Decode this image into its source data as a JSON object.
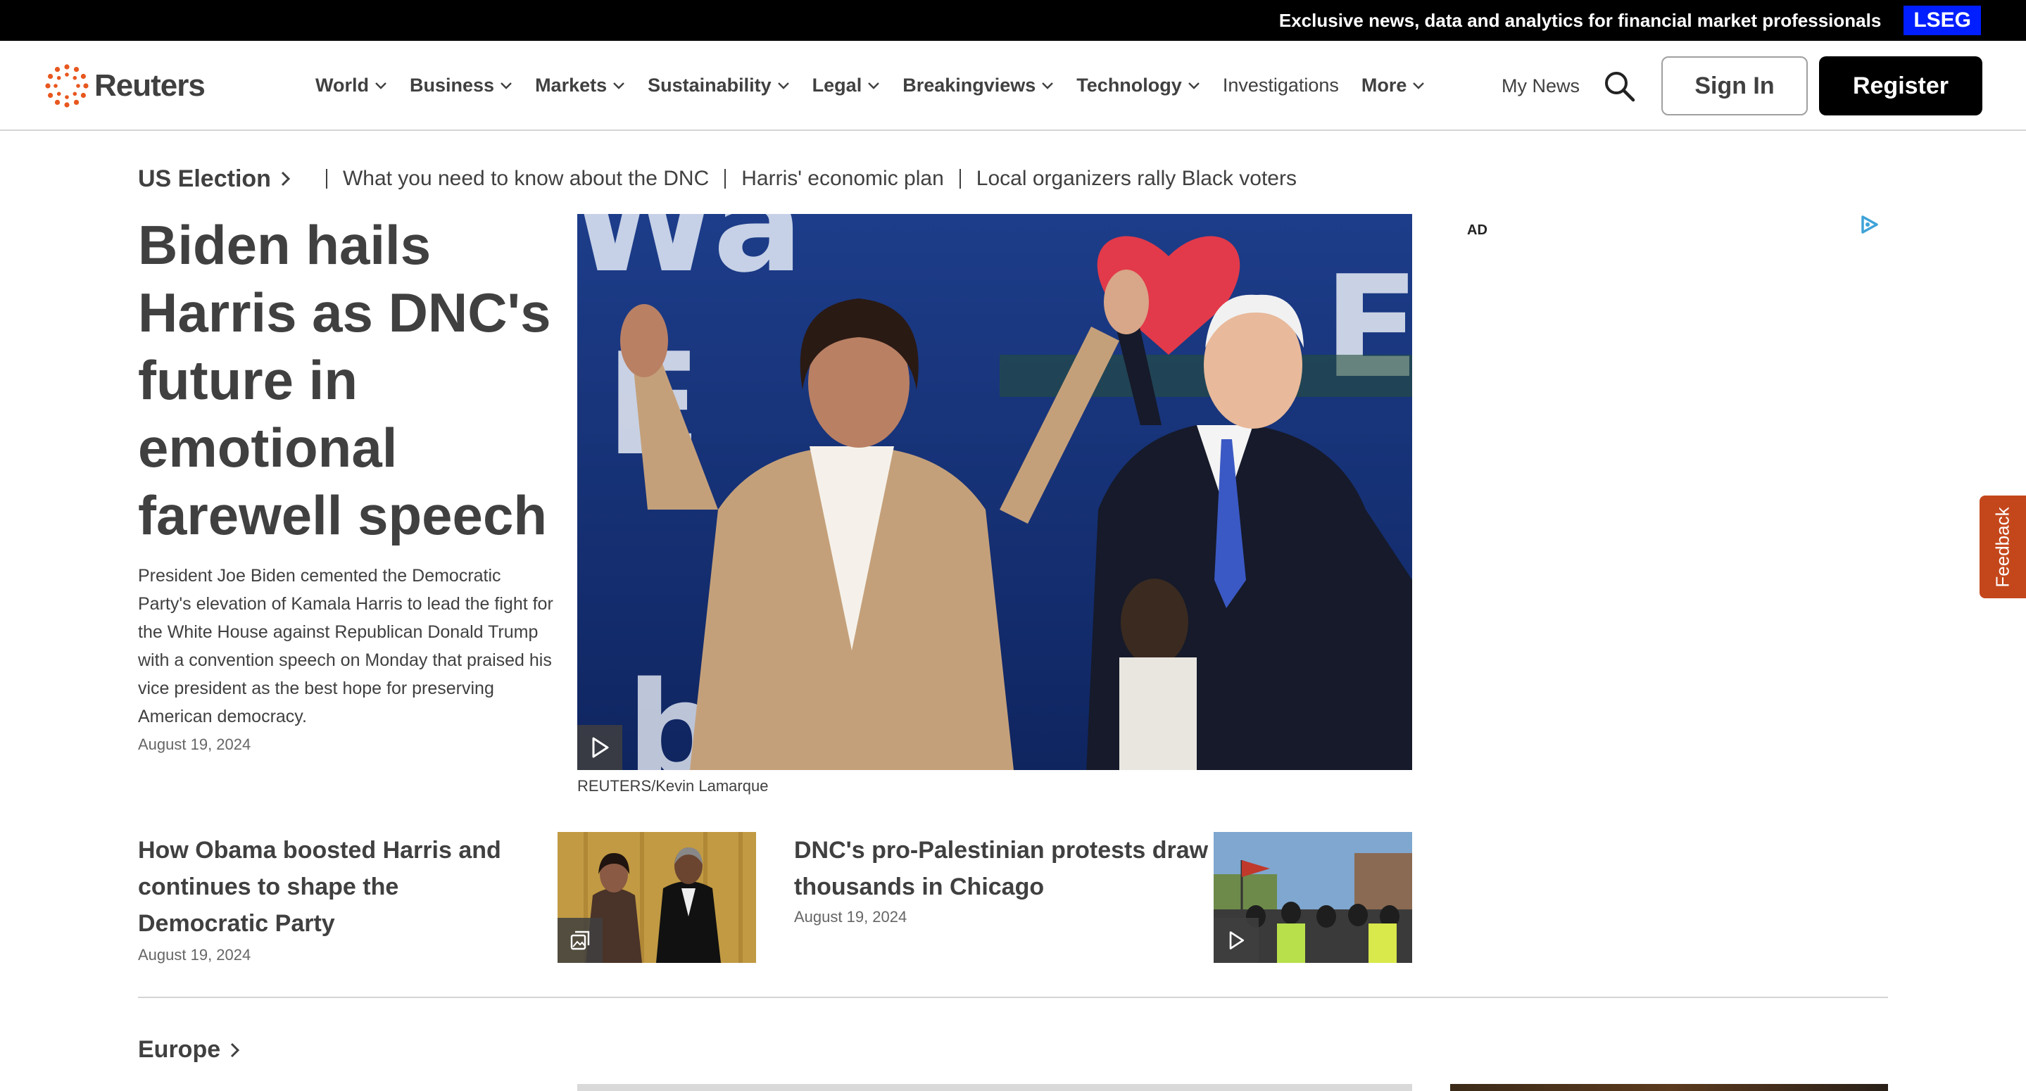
{
  "promo": {
    "text": "Exclusive news, data and analytics for financial market professionals",
    "badge": "LSEG"
  },
  "nav": {
    "logo_text": "Reuters",
    "items": [
      {
        "label": "World",
        "dropdown": true
      },
      {
        "label": "Business",
        "dropdown": true
      },
      {
        "label": "Markets",
        "dropdown": true
      },
      {
        "label": "Sustainability",
        "dropdown": true
      },
      {
        "label": "Legal",
        "dropdown": true
      },
      {
        "label": "Breakingviews",
        "dropdown": true
      },
      {
        "label": "Technology",
        "dropdown": true
      },
      {
        "label": "Investigations",
        "dropdown": false
      },
      {
        "label": "More",
        "dropdown": true
      }
    ],
    "my_news": "My News",
    "sign_in": "Sign In",
    "register": "Register"
  },
  "topic_strip": {
    "main": "US Election",
    "links": [
      "What you need to know about the DNC",
      "Harris' economic plan",
      "Local organizers rally Black voters"
    ]
  },
  "lead": {
    "headline": "Biden hails Harris as DNC's future in emotional farewell speech",
    "summary": "President Joe Biden cemented the Democratic Party's elevation of Kamala Harris to lead the fight for the White House against Republican Donald Trump with a convention speech on Monday that praised his vice president as the best hope for preserving American democracy.",
    "date": "August 19, 2024",
    "caption": "REUTERS/Kevin Lamarque",
    "media": "video"
  },
  "ad": {
    "label": "AD"
  },
  "feedback": "Feedback",
  "secondary": [
    {
      "headline": "How Obama boosted Harris and continues to shape the Democratic Party",
      "date": "August 19, 2024",
      "media": "gallery"
    },
    {
      "headline": "DNC's pro-Palestinian protests draw thousands in Chicago",
      "date": "August 19, 2024",
      "media": "video"
    }
  ],
  "next_section": {
    "title": "Europe"
  },
  "colors": {
    "text": "#404040",
    "lseg_blue": "#001eff",
    "feedback_orange": "#c4471c",
    "logo_orange": "#e8571f"
  },
  "icons": [
    "reuters-logo-icon",
    "chevron-down-icon",
    "search-icon",
    "chevron-right-icon",
    "play-icon",
    "gallery-icon",
    "adchoices-icon"
  ]
}
